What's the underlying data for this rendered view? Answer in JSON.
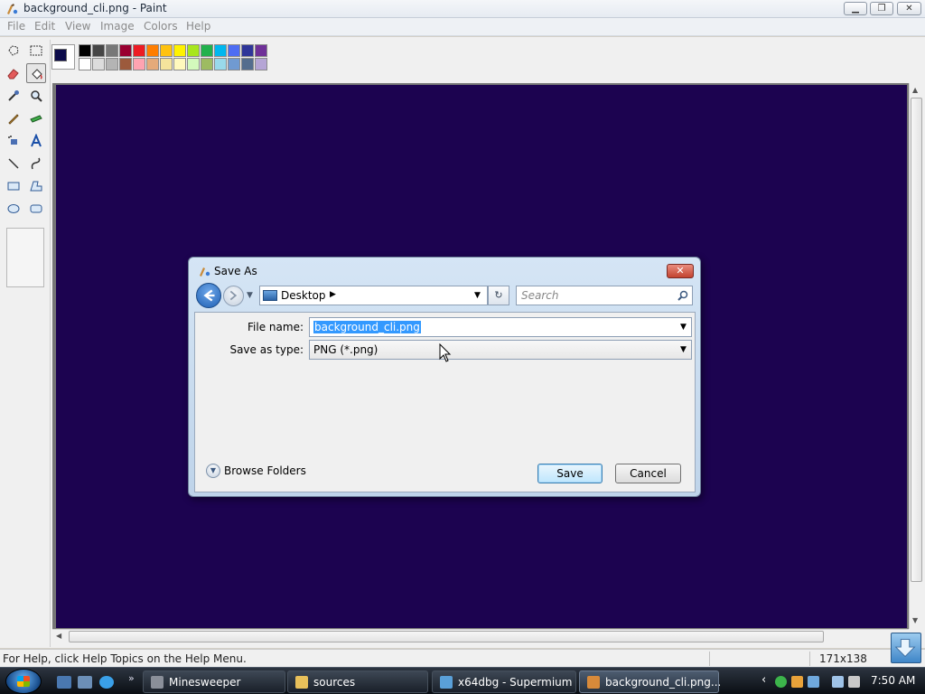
{
  "window": {
    "title": "background_cli.png - Paint",
    "controls": {
      "minimize": "▁",
      "maximize": "❐",
      "close": "✕"
    }
  },
  "menu": [
    "File",
    "Edit",
    "View",
    "Image",
    "Colors",
    "Help"
  ],
  "tools": [
    "free-select",
    "rect-select",
    "eraser",
    "fill",
    "color-picker",
    "magnifier",
    "pencil",
    "brush",
    "airbrush",
    "text",
    "line",
    "curve",
    "rectangle",
    "polygon",
    "ellipse",
    "rounded-rectangle"
  ],
  "active_tool": "fill",
  "palette": {
    "foreground": "#0b0a4a",
    "row1": [
      "#000000",
      "#464646",
      "#787878",
      "#990030",
      "#ed1c24",
      "#ff7e00",
      "#ffc20e",
      "#fff200",
      "#a8e61d",
      "#22b14c",
      "#00b7ef",
      "#4d6df3",
      "#2f3699",
      "#6f3198"
    ],
    "row2": [
      "#ffffff",
      "#dcdcdc",
      "#b4b4b4",
      "#9c5a3c",
      "#ffa3b1",
      "#e5aa7a",
      "#f5e49c",
      "#fff9bd",
      "#d3f9bc",
      "#9dbb61",
      "#99d9ea",
      "#709ad1",
      "#546d8e",
      "#b5a5d5"
    ]
  },
  "canvas": {
    "color": "#1c0350"
  },
  "statusbar": {
    "help": "For Help, click Help Topics on the Help Menu.",
    "size": "171x138"
  },
  "dialog": {
    "title": "Save As",
    "close": "✕",
    "location": "Desktop",
    "search_placeholder": "Search",
    "file_name_label": "File name:",
    "file_name_value": "background_cli.png",
    "save_as_type_label": "Save as type:",
    "save_as_type_value": "PNG (*.png)",
    "browse_folders": "Browse Folders",
    "save_button": "Save",
    "cancel_button": "Cancel",
    "refresh_glyph": "↻",
    "dropdown_glyph": "▼",
    "location_arrow": "▶",
    "expand_glyph": "▼"
  },
  "taskbar": {
    "more": "»",
    "tasks": [
      {
        "label": "Minesweeper",
        "icon_color": "#8a8f99"
      },
      {
        "label": "sources",
        "icon_color": "#e8c05a"
      },
      {
        "label": "x64dbg - Supermium",
        "icon_color": "#5aa0d8"
      },
      {
        "label": "background_cli.png...",
        "icon_color": "#d88a3a"
      }
    ],
    "active_task": "background_cli.png...",
    "tray_left": "‹",
    "clock": "7:50 AM"
  },
  "scroll": {
    "up": "▲",
    "down": "▼",
    "left": "◀",
    "right": "▶",
    "grip": "|||"
  }
}
